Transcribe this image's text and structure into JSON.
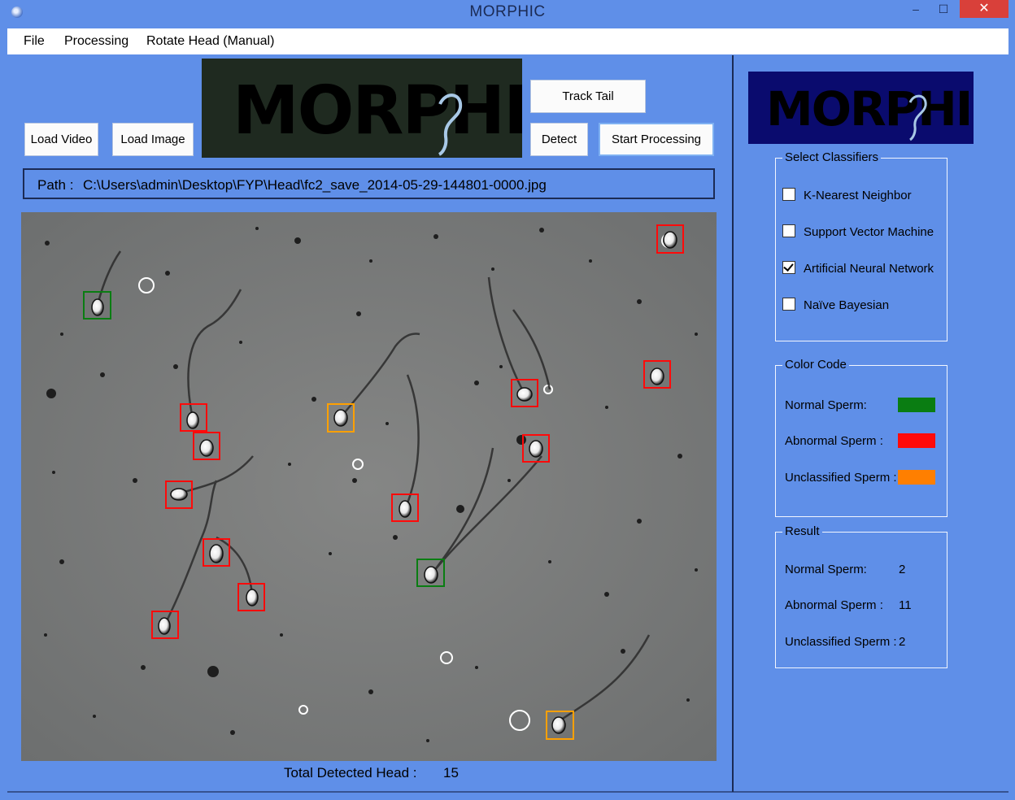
{
  "window": {
    "title": "MORPHIC",
    "minimize": "‒",
    "maximize": "☐",
    "close": "✕"
  },
  "menu": {
    "items": [
      "File",
      "Processing",
      "Rotate Head (Manual)"
    ]
  },
  "toolbar": {
    "load_video": "Load Video",
    "load_image": "Load Image",
    "track_tail": "Track Tail",
    "detect": "Detect",
    "start_processing": "Start Processing"
  },
  "logo_text": "MORPHIC",
  "path": {
    "label": "Path :",
    "value": "C:\\Users\\admin\\Desktop\\FYP\\Head\\fc2_save_2014-05-29-144801-0000.jpg"
  },
  "total": {
    "label": "Total Detected Head :",
    "value": "15"
  },
  "classifiers": {
    "legend": "Select Classifiers",
    "items": [
      {
        "label": "K-Nearest Neighbor",
        "checked": false
      },
      {
        "label": "Support Vector Machine",
        "checked": false
      },
      {
        "label": "Artificial Neural Network",
        "checked": true
      },
      {
        "label": "Naïve Bayesian",
        "checked": false
      }
    ]
  },
  "color_code": {
    "legend": "Color Code",
    "items": [
      {
        "label": "Normal Sperm:",
        "color": "#0a7d12"
      },
      {
        "label": "Abnormal Sperm :",
        "color": "#ff0a0a"
      },
      {
        "label": "Unclassified Sperm :",
        "color": "#ff7f00"
      }
    ]
  },
  "result": {
    "legend": "Result",
    "items": [
      {
        "label": "Normal Sperm:",
        "value": "2"
      },
      {
        "label": "Abnormal Sperm :",
        "value": "11"
      },
      {
        "label": "Unclassified Sperm :",
        "value": "2"
      }
    ]
  }
}
